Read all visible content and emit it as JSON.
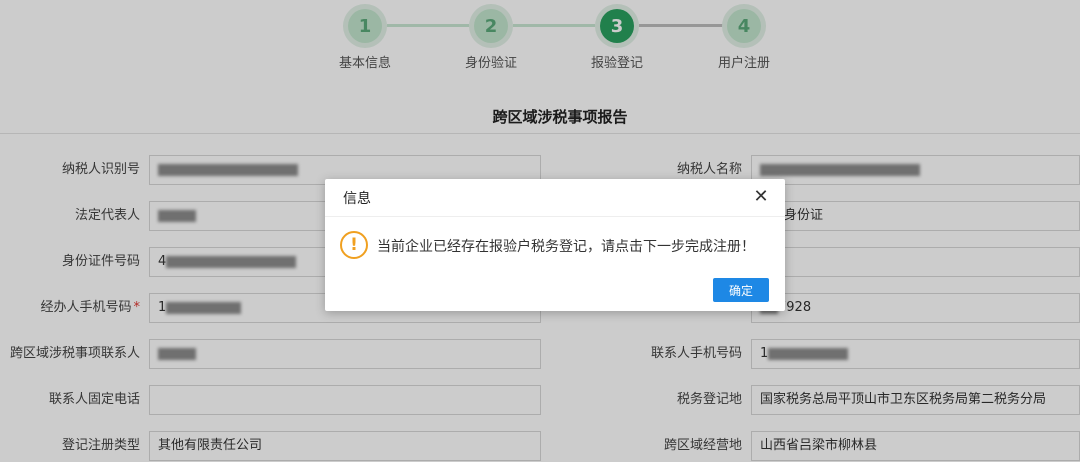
{
  "steps": [
    {
      "number": "1",
      "label": "基本信息"
    },
    {
      "number": "2",
      "label": "身份验证"
    },
    {
      "number": "3",
      "label": "报验登记"
    },
    {
      "number": "4",
      "label": "用户注册"
    }
  ],
  "form": {
    "title": "跨区域涉税事项报告",
    "left": [
      {
        "label": "纳税人识别号",
        "value": "",
        "required": false
      },
      {
        "label": "法定代表人",
        "value": "",
        "required": false
      },
      {
        "label": "身份证件号码",
        "value": "4",
        "required": false
      },
      {
        "label": "经办人手机号码",
        "value": "1",
        "required": true
      },
      {
        "label": "跨区域涉税事项联系人",
        "value": "",
        "required": false
      },
      {
        "label": "联系人固定电话",
        "value": "",
        "required": false
      },
      {
        "label": "登记注册类型",
        "value": "其他有限责任公司",
        "required": false
      }
    ],
    "right": [
      {
        "label": "纳税人名称",
        "value": ""
      },
      {
        "label": "",
        "value": "身份证"
      },
      {
        "label": "",
        "value": ""
      },
      {
        "label": "",
        "value": "7928"
      },
      {
        "label": "联系人手机号码",
        "value": "1"
      },
      {
        "label": "税务登记地",
        "value": "国家税务总局平顶山市卫东区税务局第二税务分局"
      },
      {
        "label": "跨区域经营地",
        "value": "山西省吕梁市柳林县"
      }
    ]
  },
  "dialog": {
    "title": "信息",
    "message": "当前企业已经存在报验户税务登记，请点击下一步完成注册！",
    "ok_label": "确定",
    "icon": "warning-icon",
    "close_icon": "close-icon"
  },
  "colors": {
    "step_active": "#2aa05f",
    "primary_button": "#1e88e5",
    "warning": "#f0a020",
    "required": "#e0342f"
  }
}
